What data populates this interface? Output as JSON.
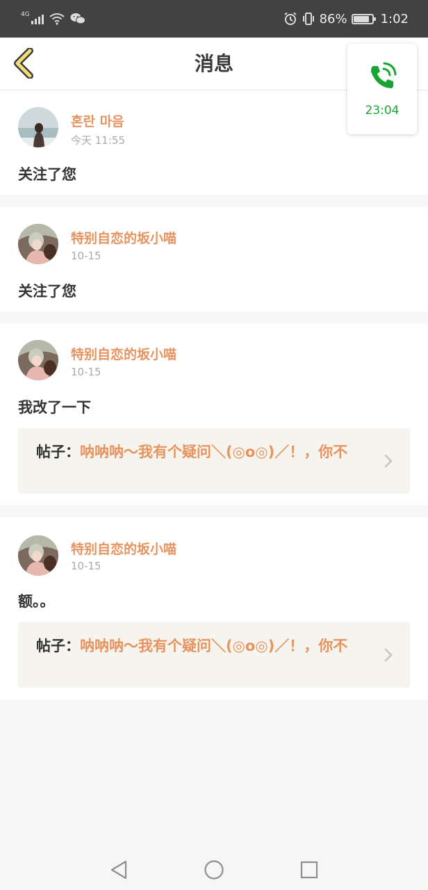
{
  "status_bar": {
    "network": "4G",
    "battery_percent": "86%",
    "battery_level": 0.86,
    "time": "1:02",
    "icons": [
      "signal-icon",
      "wifi-icon",
      "wechat-icon",
      "alarm-icon",
      "vibrate-icon",
      "battery-icon"
    ]
  },
  "header": {
    "title": "消息",
    "back_icon": "chevron-left-icon"
  },
  "call_overlay": {
    "icon": "phone-icon",
    "duration": "23:04",
    "color": "#1aa532"
  },
  "messages": [
    {
      "username": "혼란 마음",
      "time": "今天 11:55",
      "content": "关注了您"
    },
    {
      "username": "特别自恋的坂小喵",
      "time": "10-15",
      "content": "关注了您"
    },
    {
      "username": "特别自恋的坂小喵",
      "time": "10-15",
      "content": "我改了一下",
      "post": {
        "label": "帖子：",
        "title": "呐呐呐～我有个疑问＼(◎o◎)／！，你不"
      }
    },
    {
      "username": "特别自恋的坂小喵",
      "time": "10-15",
      "content": "额。。",
      "post": {
        "label": "帖子：",
        "title": "呐呐呐～我有个疑问＼(◎o◎)／！，你不"
      }
    }
  ],
  "colors": {
    "accent": "#e7935f",
    "status_bar": "#424242",
    "post_bg": "#f5f4ee"
  },
  "nav_bar": {
    "buttons": [
      "back-triangle-icon",
      "home-circle-icon",
      "recents-square-icon"
    ]
  }
}
